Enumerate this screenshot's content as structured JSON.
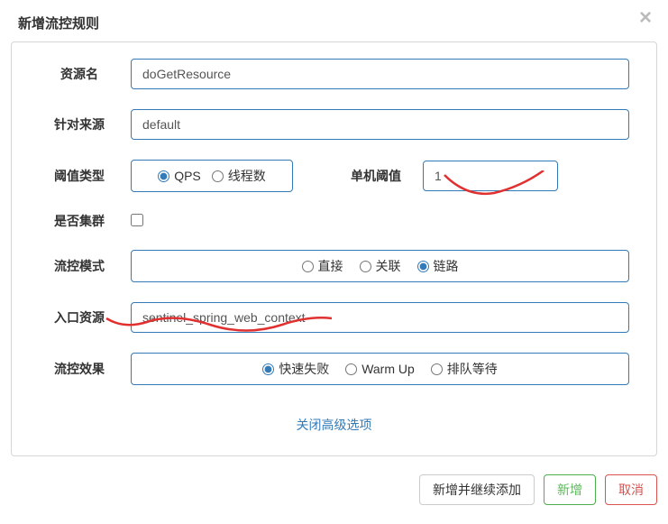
{
  "header": {
    "title": "新增流控规则",
    "close": "×"
  },
  "form": {
    "resourceName": {
      "label": "资源名",
      "value": "doGetResource"
    },
    "source": {
      "label": "针对来源",
      "value": "default"
    },
    "thresholdType": {
      "label": "阈值类型",
      "qps": "QPS",
      "threads": "线程数"
    },
    "threshold": {
      "label": "单机阈值",
      "value": "1"
    },
    "cluster": {
      "label": "是否集群"
    },
    "mode": {
      "label": "流控模式",
      "direct": "直接",
      "relate": "关联",
      "chain": "链路"
    },
    "entry": {
      "label": "入口资源",
      "value": "sentinel_spring_web_context"
    },
    "effect": {
      "label": "流控效果",
      "fastFail": "快速失败",
      "warmUp": "Warm Up",
      "queue": "排队等待"
    },
    "advanced": "关闭高级选项"
  },
  "footer": {
    "addContinue": "新增并继续添加",
    "add": "新增",
    "cancel": "取消"
  }
}
